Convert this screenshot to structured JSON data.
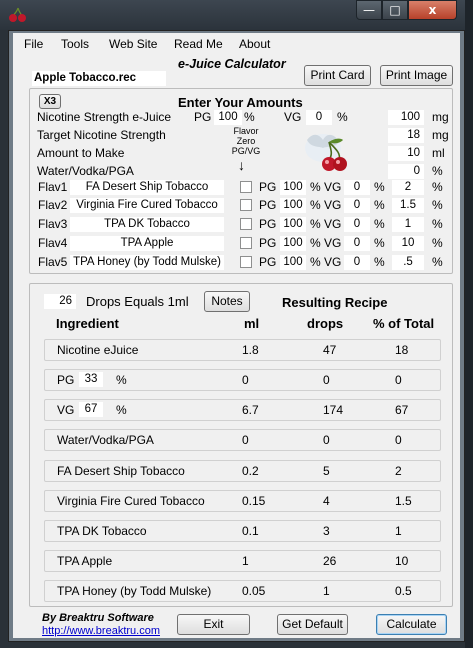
{
  "window": {
    "min_glyph": "—",
    "max_glyph": "□",
    "close_glyph": "x"
  },
  "menu": [
    "File",
    "Tools",
    "Web Site",
    "Read Me",
    "About"
  ],
  "filename": "Apple Tobacco.rec",
  "app_title": "e-Juice Calculator",
  "buttons": {
    "print_card": "Print Card",
    "print_image": "Print Image",
    "x3": "X3",
    "notes": "Notes",
    "exit": "Exit",
    "get_default": "Get Default",
    "calculate": "Calculate"
  },
  "amounts": {
    "heading": "Enter Your Amounts",
    "nic_label": "Nicotine Strength e-Juice",
    "pg_label": "PG",
    "pg_value": "100",
    "pct": "%",
    "vg_label": "VG",
    "vg_value": "0",
    "nic_value": "100",
    "nic_unit": "mg",
    "target_label": "Target Nicotine Strength",
    "target_value": "18",
    "target_unit": "mg",
    "make_label": "Amount to Make",
    "make_value": "10",
    "make_unit": "ml",
    "water_label": "Water/Vodka/PGA",
    "water_value": "0",
    "water_unit": "%",
    "flavor_zero_label": "Flavor\nZero\nPG/VG",
    "flavor_zero_arrow": "↓"
  },
  "flavors": [
    {
      "label": "Flav1",
      "name": "FA Desert Ship Tobacco",
      "pg": "100",
      "vg": "0",
      "pct": "2"
    },
    {
      "label": "Flav2",
      "name": "Virginia Fire Cured Tobacco",
      "pg": "100",
      "vg": "0",
      "pct": "1.5"
    },
    {
      "label": "Flav3",
      "name": "TPA DK Tobacco",
      "pg": "100",
      "vg": "0",
      "pct": "1"
    },
    {
      "label": "Flav4",
      "name": "TPA Apple",
      "pg": "100",
      "vg": "0",
      "pct": "10"
    },
    {
      "label": "Flav5",
      "name": "TPA Honey (by Todd Mulske)",
      "pg": "100",
      "vg": "0",
      "pct": ".5"
    }
  ],
  "drops": {
    "value": "26",
    "label": "Drops Equals 1ml"
  },
  "recipe": {
    "heading": "Resulting Recipe",
    "columns": [
      "Ingredient",
      "ml",
      "drops",
      "% of Total"
    ],
    "pg_box": "33",
    "vg_box": "67",
    "pct_sign": "%",
    "rows": [
      {
        "name": "Nicotine eJuice",
        "ml": "1.8",
        "drops": "47",
        "pct": "18"
      },
      {
        "name": "PG",
        "ml": "0",
        "drops": "0",
        "pct": "0"
      },
      {
        "name": "VG",
        "ml": "6.7",
        "drops": "174",
        "pct": "67"
      },
      {
        "name": "Water/Vodka/PGA",
        "ml": "0",
        "drops": "0",
        "pct": "0"
      },
      {
        "name": "FA Desert Ship Tobacco",
        "ml": "0.2",
        "drops": "5",
        "pct": "2"
      },
      {
        "name": "Virginia Fire Cured Tobacco",
        "ml": "0.15",
        "drops": "4",
        "pct": "1.5"
      },
      {
        "name": "TPA DK Tobacco",
        "ml": "0.1",
        "drops": "3",
        "pct": "1"
      },
      {
        "name": "TPA Apple",
        "ml": "1",
        "drops": "26",
        "pct": "10"
      },
      {
        "name": "TPA Honey (by Todd Mulske)",
        "ml": "0.05",
        "drops": "1",
        "pct": "0.5"
      }
    ]
  },
  "footer": {
    "by": "By Breaktru Software",
    "url": "http://www.breaktru.com"
  },
  "colors": {
    "title_italic": "#000000",
    "link": "#0000cc",
    "cherry": "#c0182a",
    "close_button": "#c7533b"
  }
}
